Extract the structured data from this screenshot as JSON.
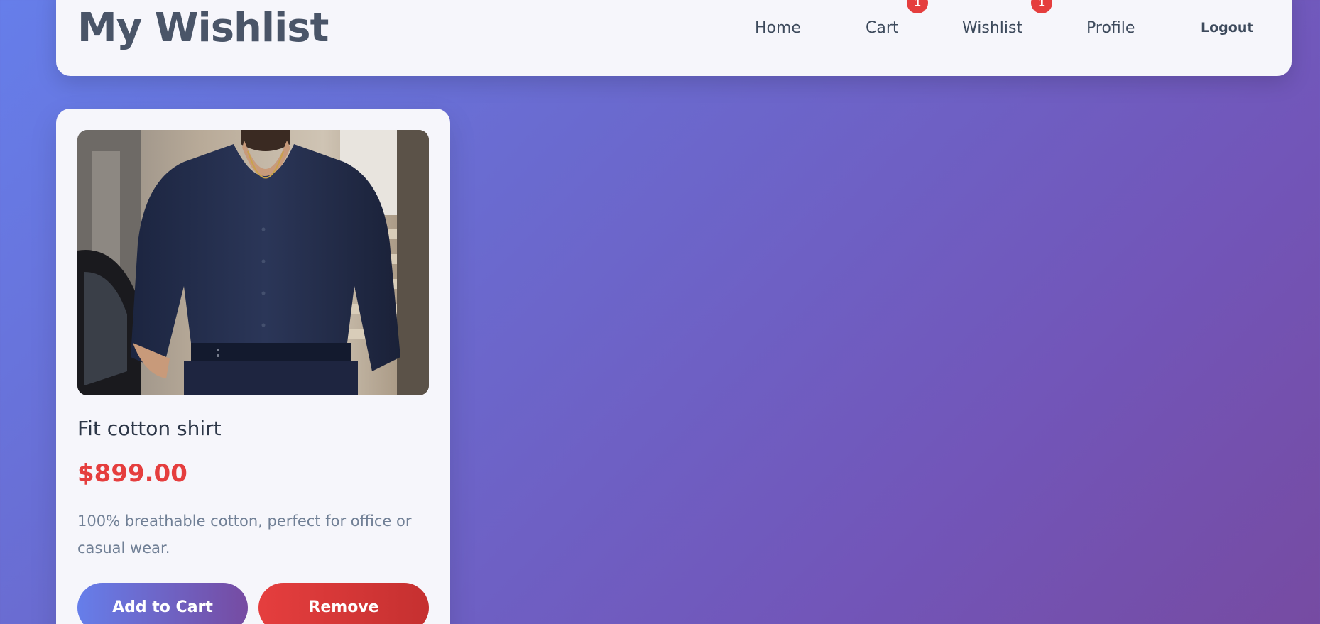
{
  "header": {
    "title": "My Wishlist",
    "nav": [
      {
        "label": "Home"
      },
      {
        "label": "Cart",
        "badge": "1"
      },
      {
        "label": "Wishlist",
        "badge": "1"
      },
      {
        "label": "Profile"
      },
      {
        "label": "Logout"
      }
    ]
  },
  "wishlist": {
    "items": [
      {
        "name": "Fit cotton shirt",
        "price": "$899.00",
        "description": "100% breathable cotton, perfect for office or casual wear.",
        "image": "navy-shirt-photo",
        "add_to_cart_label": "Add to Cart",
        "remove_label": "Remove"
      }
    ]
  },
  "colors": {
    "accent_start": "#667eea",
    "accent_end": "#764ba2",
    "danger": "#e53e3e",
    "badge": "#e53e3e",
    "card_bg": "#f6f6fb"
  }
}
